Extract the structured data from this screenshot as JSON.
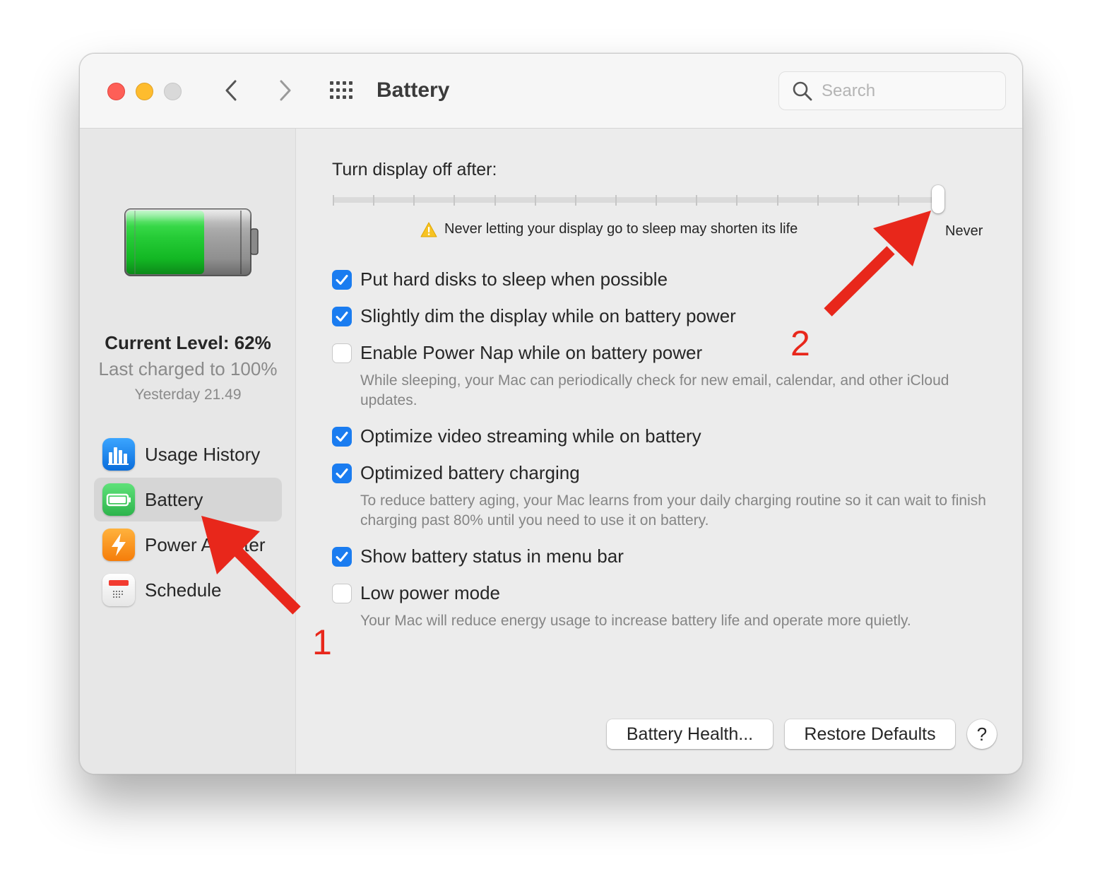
{
  "window": {
    "title": "Battery",
    "search_placeholder": "Search"
  },
  "sidebar": {
    "current_level": "Current Level: 62%",
    "last_charged": "Last charged to 100%",
    "charged_time": "Yesterday 21.49",
    "battery_level": 0.62,
    "items": [
      {
        "label": "Usage History",
        "icon": "bar-chart-icon"
      },
      {
        "label": "Battery",
        "icon": "battery-icon",
        "selected": true
      },
      {
        "label": "Power Adapter",
        "icon": "lightning-icon"
      },
      {
        "label": "Schedule",
        "icon": "calendar-icon"
      }
    ]
  },
  "display_sleep": {
    "title": "Turn display off after:",
    "value_label": "Never",
    "value_fraction": 1.0,
    "warning": "Never letting your display go to sleep may shorten its life"
  },
  "options": [
    {
      "label": "Put hard disks to sleep when possible",
      "checked": true
    },
    {
      "label": "Slightly dim the display while on battery power",
      "checked": true
    },
    {
      "label": "Enable Power Nap while on battery power",
      "checked": false,
      "description": "While sleeping, your Mac can periodically check for new email, calendar, and other iCloud updates."
    },
    {
      "label": "Optimize video streaming while on battery",
      "checked": true
    },
    {
      "label": "Optimized battery charging",
      "checked": true,
      "description": "To reduce battery aging, your Mac learns from your daily charging routine so it can wait to finish charging past 80% until you need to use it on battery."
    },
    {
      "label": "Show battery status in menu bar",
      "checked": true
    },
    {
      "label": "Low power mode",
      "checked": false,
      "description": "Your Mac will reduce energy usage to increase battery life and operate more quietly."
    }
  ],
  "buttons": {
    "battery_health": "Battery Health...",
    "restore_defaults": "Restore Defaults",
    "help": "?"
  },
  "annotations": {
    "marker_1": "1",
    "marker_2": "2",
    "color": "#e8271b"
  },
  "colors": {
    "checkbox_accent": "#1a7cf0",
    "battery_green": "#2db44c"
  }
}
